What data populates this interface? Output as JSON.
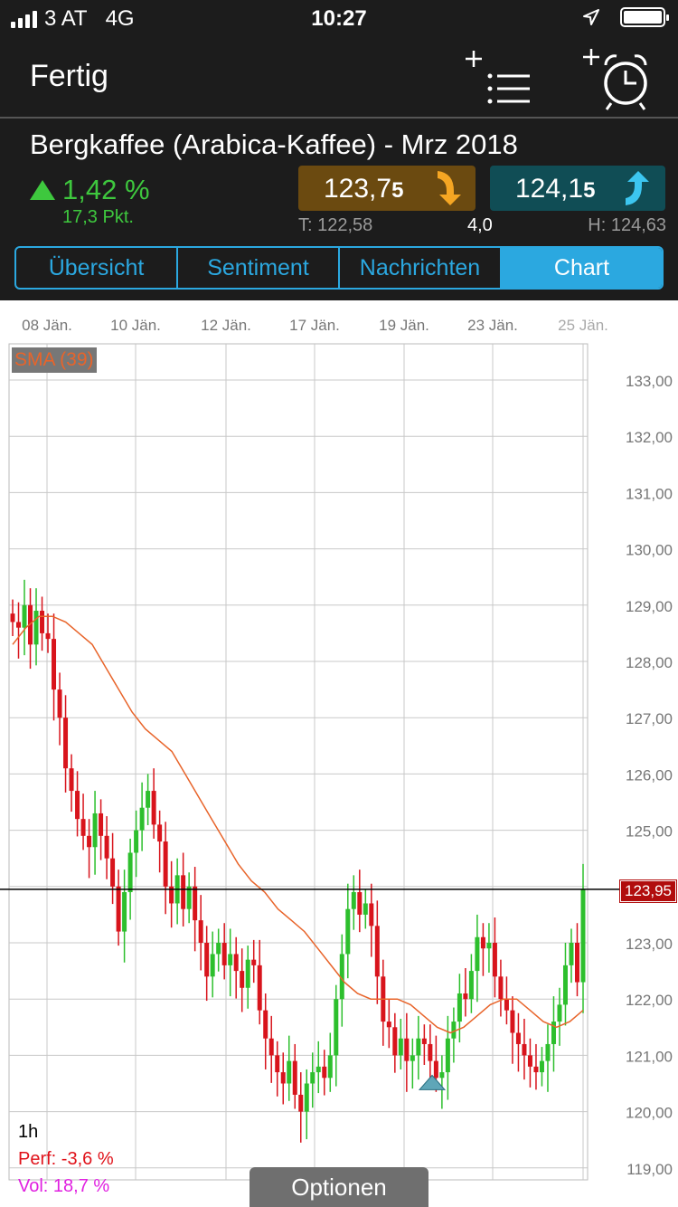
{
  "status_bar": {
    "carrier": "3 AT",
    "network": "4G",
    "time": "10:27"
  },
  "nav": {
    "done_label": "Fertig",
    "add_watchlist_icon": "add-to-list-icon",
    "add_alarm_icon": "add-alarm-clock-icon"
  },
  "instrument": {
    "title": "Bergkaffee (Arabica-Kaffee) - Mrz 2018",
    "change_pct": "1,42 %",
    "change_pts": "17,3 Pkt.",
    "sell_price_main": "123,7",
    "sell_price_last": "5",
    "buy_price_main": "124,1",
    "buy_price_last": "5",
    "low": "T: 122,58",
    "spread": "4,0",
    "high": "H: 124,63"
  },
  "tabs": [
    {
      "label": "Übersicht",
      "active": false
    },
    {
      "label": "Sentiment",
      "active": false
    },
    {
      "label": "Nachrichten",
      "active": false
    },
    {
      "label": "Chart",
      "active": true
    }
  ],
  "chart": {
    "indicator_label": "SMA (39)",
    "interval": "1h",
    "perf": "Perf: -3,6 %",
    "vol": "Vol: 18,7 %",
    "options_label": "Optionen",
    "current_price_label": "123,95"
  },
  "chart_data": {
    "type": "candlestick",
    "x_tick_labels": [
      "08 Jän.",
      "10 Jän.",
      "12 Jän.",
      "17 Jän.",
      "19 Jän.",
      "23 Jän.",
      "25 Jän."
    ],
    "y_tick_labels": [
      "133,00",
      "132,00",
      "131,00",
      "130,00",
      "129,00",
      "128,00",
      "127,00",
      "126,00",
      "125,00",
      "124,00",
      "123,00",
      "122,00",
      "121,00",
      "120,00",
      "119,00"
    ],
    "ylim": [
      118.8,
      133.3
    ],
    "current_price": 123.95,
    "up_color": "#2dbf2d",
    "down_color": "#d8141c",
    "sma_color": "#e8642a",
    "close_series": [
      128.7,
      128.6,
      129.0,
      128.3,
      128.9,
      128.5,
      128.4,
      127.5,
      127.0,
      126.1,
      125.7,
      125.2,
      124.9,
      124.7,
      125.3,
      124.9,
      124.5,
      124.0,
      123.2,
      123.9,
      124.6,
      125.0,
      125.4,
      125.7,
      125.1,
      124.8,
      124.0,
      123.7,
      124.2,
      123.6,
      124.0,
      123.4,
      123.0,
      122.4,
      122.8,
      123.0,
      122.6,
      122.8,
      122.5,
      122.2,
      122.7,
      122.6,
      121.8,
      121.3,
      121.0,
      120.7,
      120.5,
      120.9,
      120.3,
      120.0,
      120.5,
      120.7,
      120.8,
      120.6,
      121.0,
      122.0,
      122.8,
      123.6,
      123.9,
      123.5,
      123.7,
      123.3,
      122.4,
      121.6,
      121.5,
      121.0,
      121.3,
      120.9,
      121.0,
      121.3,
      121.2,
      120.9,
      120.6,
      120.7,
      121.3,
      121.6,
      122.1,
      122.0,
      122.5,
      123.1,
      122.9,
      123.0,
      122.4,
      122.0,
      121.8,
      121.4,
      121.2,
      121.0,
      120.8,
      120.7,
      120.9,
      121.2,
      121.6,
      121.9,
      122.6,
      123.0,
      122.3,
      123.95
    ],
    "sma_series": [
      128.3,
      128.6,
      128.8,
      128.8,
      128.7,
      128.5,
      128.3,
      127.9,
      127.5,
      127.1,
      126.8,
      126.6,
      126.4,
      126.0,
      125.6,
      125.2,
      124.8,
      124.4,
      124.1,
      123.9,
      123.6,
      123.4,
      123.2,
      122.9,
      122.6,
      122.3,
      122.1,
      122.0,
      122.0,
      122.0,
      121.9,
      121.7,
      121.5,
      121.4,
      121.5,
      121.7,
      121.9,
      122.0,
      122.0,
      121.8,
      121.6,
      121.5,
      121.6,
      121.8
    ]
  }
}
